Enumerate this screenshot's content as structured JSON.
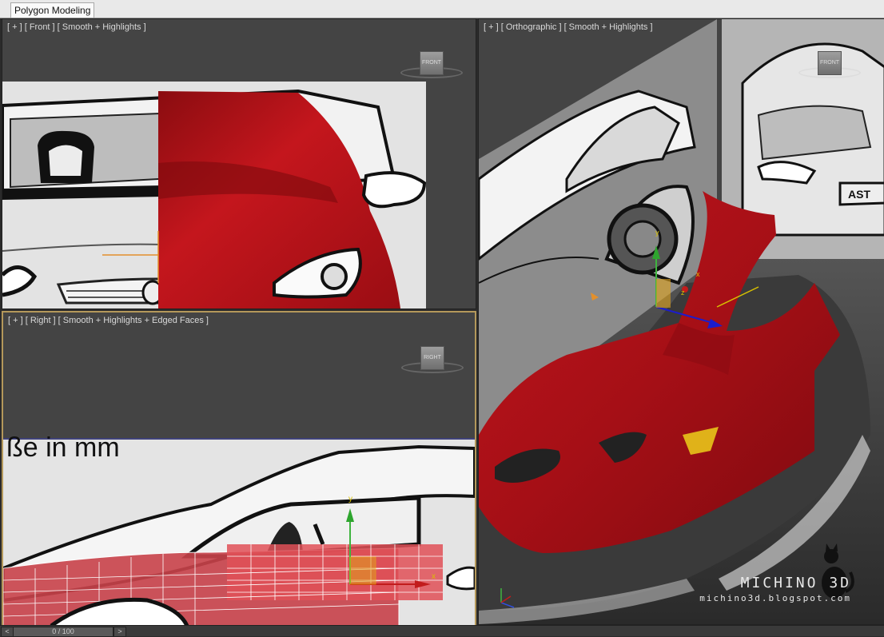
{
  "ribbon": {
    "active_tab": "Polygon Modeling"
  },
  "viewports": {
    "front": {
      "label": "[ + ] [ Front ] [ Smooth + Highlights ]",
      "cube_label": "FRONT"
    },
    "right": {
      "label": "[ + ] [ Right ] [ Smooth + Highlights + Edged Faces ]",
      "cube_label": "RIGHT",
      "caption": "ße in mm"
    },
    "perspective": {
      "label": "[ + ] [ Orthographic ] [ Smooth + Highlights ]",
      "cube_label": "FRONT"
    }
  },
  "gizmo": {
    "x": "x",
    "y": "y",
    "z": "z"
  },
  "watermark": {
    "title": "MICHINO 3D",
    "url": "michino3d.blogspot.com"
  },
  "timeline": {
    "frame_display": "0 / 100",
    "prev": "<",
    "next": ">"
  },
  "colors": {
    "model_red": "#b3121a",
    "viewport_bg": "#444444",
    "active_border": "#b4985a"
  },
  "icons": {
    "cat": "cat-silhouette-icon"
  }
}
